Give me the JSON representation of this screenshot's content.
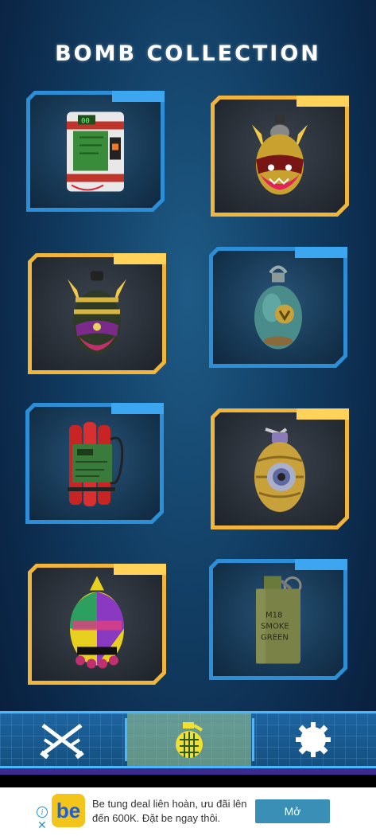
{
  "header": {
    "title": "BOMB COLLECTION"
  },
  "cards": [
    {
      "name": "c4-timer-bomb",
      "frame": "blue"
    },
    {
      "name": "horned-red-grenade",
      "frame": "gold"
    },
    {
      "name": "horned-green-grenade",
      "frame": "gold"
    },
    {
      "name": "teal-egg-grenade",
      "frame": "blue"
    },
    {
      "name": "dynamite-bundle",
      "frame": "blue"
    },
    {
      "name": "eye-grenade",
      "frame": "gold"
    },
    {
      "name": "rainbow-grenade",
      "frame": "gold"
    },
    {
      "name": "m18-smoke-grenade",
      "frame": "blue"
    }
  ],
  "smoke_grenade": {
    "line1": "M18",
    "line2": "SMOKE",
    "line3": "GREEN"
  },
  "c4": {
    "display": "00"
  },
  "navbar": {
    "items": [
      {
        "icon": "crossed-rifles-icon",
        "active": false
      },
      {
        "icon": "grenade-icon",
        "active": true
      },
      {
        "icon": "gear-mine-icon",
        "active": false
      }
    ]
  },
  "ad": {
    "logo": "be",
    "text": "Be tung deal liên hoàn, ưu đãi lên đến 600K. Đặt be ngay thôi.",
    "button": "Mở",
    "info": "i",
    "close": "✕"
  },
  "colors": {
    "blue_frame": "#2b8ed6",
    "gold_frame": "#f0b53a",
    "nav_border": "#49b8ff",
    "ad_button": "#3a8fb7"
  }
}
